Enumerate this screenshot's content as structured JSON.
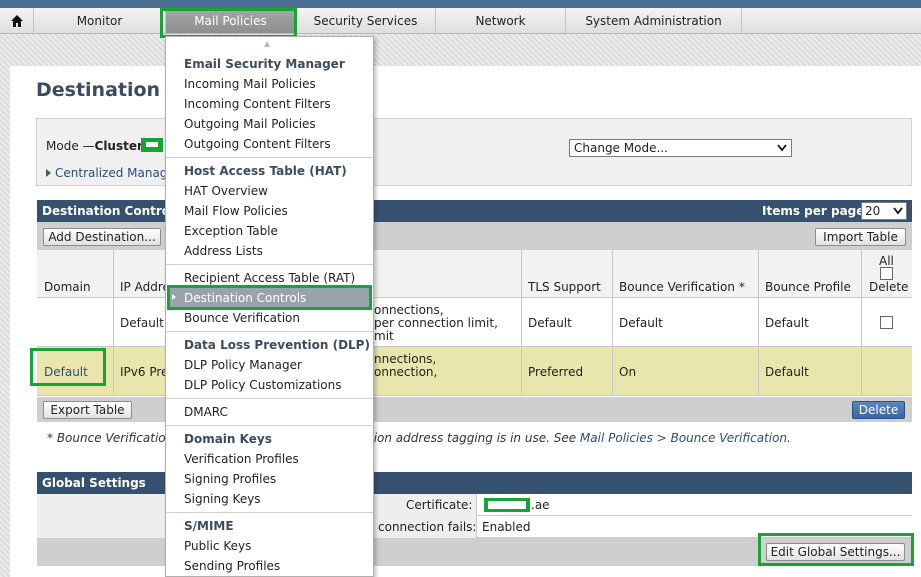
{
  "nav": {
    "home_icon": "home-icon",
    "tabs": [
      "Monitor",
      "Mail Policies",
      "Security Services",
      "Network",
      "System Administration"
    ]
  },
  "page": {
    "title": "Destination C",
    "mode_prefix": "Mode —",
    "mode_cluster_label": "Cluster:",
    "change_mode": "Change Mode...",
    "centralized_link": "Centralized Manage"
  },
  "dest_controls": {
    "title": "Destination Control",
    "items_per_page_label": "Items per page",
    "items_per_page_value": "20",
    "add_button": "Add Destination...",
    "import_button": "Import Table",
    "export_button": "Export Table",
    "delete_button": "Delete",
    "columns": {
      "domain": "Domain",
      "ip_address": "IP Addre",
      "tls": "TLS Support",
      "bounce_verification": "Bounce Verification *",
      "bounce_profile": "Bounce Profile",
      "all": "All",
      "delete": "Delete"
    },
    "rows": [
      {
        "domain": "",
        "ip": "Default",
        "limits": [
          "onnections,",
          "per connection limit,",
          "mit"
        ],
        "tls": "Default",
        "bounce_verification": "Default",
        "bounce_profile": "Default"
      },
      {
        "domain": "Default",
        "ip": "IPv6 Pre",
        "limits": [
          "nnections,",
          "onnection,"
        ],
        "tls": "Preferred",
        "bounce_verification": "On",
        "bounce_profile": "Default"
      }
    ],
    "footnote_left": "* Bounce Verification",
    "footnote_right_text": "tion address tagging is in use. See ",
    "footnote_link": "Mail Policies > Bounce Verification",
    "footnote_end": "."
  },
  "global_settings": {
    "title": "Global Settings",
    "certificate_label": "Certificate:",
    "certificate_suffix": ".ae",
    "tls_fail_label": "connection fails:",
    "tls_fail_value": "Enabled",
    "edit_button": "Edit Global Settings..."
  },
  "menu": {
    "sections": [
      {
        "header": "Email Security Manager",
        "items": [
          "Incoming Mail Policies",
          "Incoming Content Filters",
          "Outgoing Mail Policies",
          "Outgoing Content Filters"
        ]
      },
      {
        "header": "Host Access Table (HAT)",
        "items": [
          "HAT Overview",
          "Mail Flow Policies",
          "Exception Table",
          "Address Lists"
        ]
      },
      {
        "header": "",
        "items": [
          "Recipient Access Table (RAT)",
          "Destination Controls",
          "Bounce Verification"
        ]
      },
      {
        "header": "Data Loss Prevention (DLP)",
        "items": [
          "DLP Policy Manager",
          "DLP Policy Customizations"
        ]
      },
      {
        "header": "",
        "items": [
          "DMARC"
        ]
      },
      {
        "header": "Domain Keys",
        "items": [
          "Verification Profiles",
          "Signing Profiles",
          "Signing Keys"
        ]
      },
      {
        "header": "S/MIME",
        "items": [
          "Public Keys",
          "Sending Profiles"
        ]
      }
    ]
  },
  "colors": {
    "highlight_box": "#17a437",
    "table_header": "#36516f",
    "selected_row": "#e9e6ad"
  }
}
